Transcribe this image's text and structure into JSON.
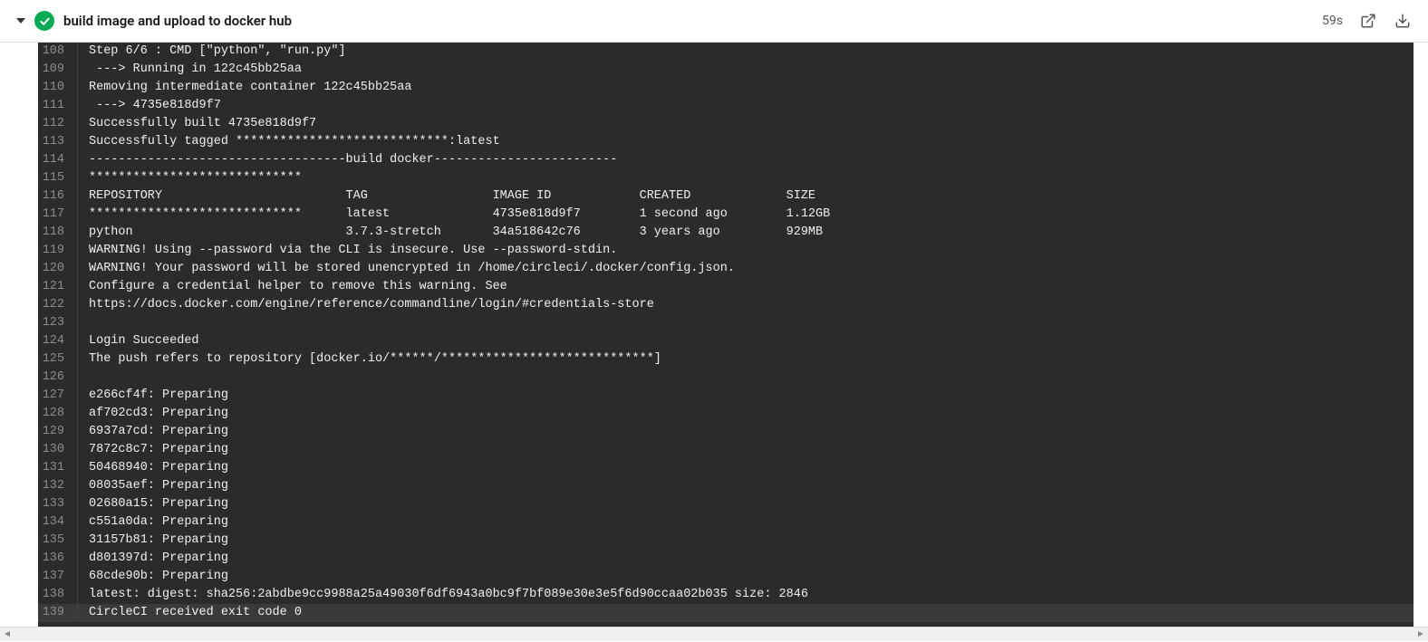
{
  "header": {
    "title": "build image and upload to docker hub",
    "duration": "59s"
  },
  "log_start": 108,
  "log_lines": [
    "Step 6/6 : CMD [\"python\", \"run.py\"]",
    " ---> Running in 122c45bb25aa",
    "Removing intermediate container 122c45bb25aa",
    " ---> 4735e818d9f7",
    "Successfully built 4735e818d9f7",
    "Successfully tagged *****************************:latest",
    "-----------------------------------build docker-------------------------",
    "*****************************",
    "REPOSITORY                         TAG                 IMAGE ID            CREATED             SIZE",
    "*****************************      latest              4735e818d9f7        1 second ago        1.12GB",
    "python                             3.7.3-stretch       34a518642c76        3 years ago         929MB",
    "WARNING! Using --password via the CLI is insecure. Use --password-stdin.",
    "WARNING! Your password will be stored unencrypted in /home/circleci/.docker/config.json.",
    "Configure a credential helper to remove this warning. See",
    "https://docs.docker.com/engine/reference/commandline/login/#credentials-store",
    "",
    "Login Succeeded",
    "The push refers to repository [docker.io/******/*****************************]",
    "",
    "e266cf4f: Preparing ",
    "af702cd3: Preparing ",
    "6937a7cd: Preparing ",
    "7872c8c7: Preparing ",
    "50468940: Preparing ",
    "08035aef: Preparing ",
    "02680a15: Preparing ",
    "c551a0da: Preparing ",
    "31157b81: Preparing ",
    "d801397d: Preparing ",
    "68cde90b: Preparing ",
    "latest: digest: sha256:2abdbe9cc9988a25a49030f6df6943a0bc9f7bf089e30e3e5f6d90ccaa02b035 size: 2846",
    "CircleCI received exit code 0"
  ],
  "highlight_line": 139
}
